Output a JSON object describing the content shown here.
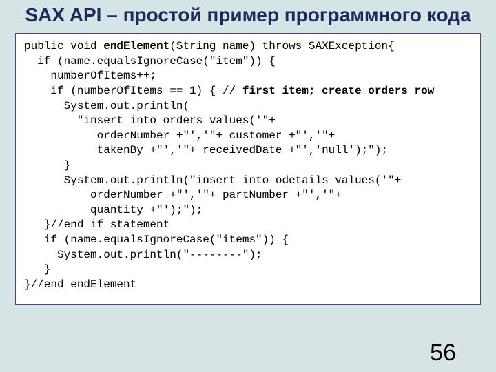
{
  "title": "SAX API – простой пример программного кода",
  "code": {
    "l1a": "public void ",
    "l1b": "endElement",
    "l1c": "(String name) throws SAXException{",
    "l2": "  if (name.equalsIgnoreCase(\"item\")) {",
    "l3": "    numberOfItems++;",
    "l4a": "    if (numberOfItems == 1) { // ",
    "l4b": "first item; create orders row",
    "l5": "      System.out.println(",
    "l6": "        \"insert into orders values('\"+",
    "l7": "           orderNumber +\"','\"+ customer +\"','\"+",
    "l8": "           takenBy +\"','\"+ receivedDate +\"','null');\");",
    "l9": "      }",
    "l10": "      System.out.println(\"insert into odetails values('\"+",
    "l11": "          orderNumber +\"','\"+ partNumber +\"','\"+",
    "l12": "          quantity +\"');\");",
    "l13": "   }//end if statement",
    "l14": "   if (name.equalsIgnoreCase(\"items\")) {",
    "l15": "     System.out.println(\"--------\");",
    "l16": "   }",
    "l17": "}//end endElement"
  },
  "pagenum": "56"
}
